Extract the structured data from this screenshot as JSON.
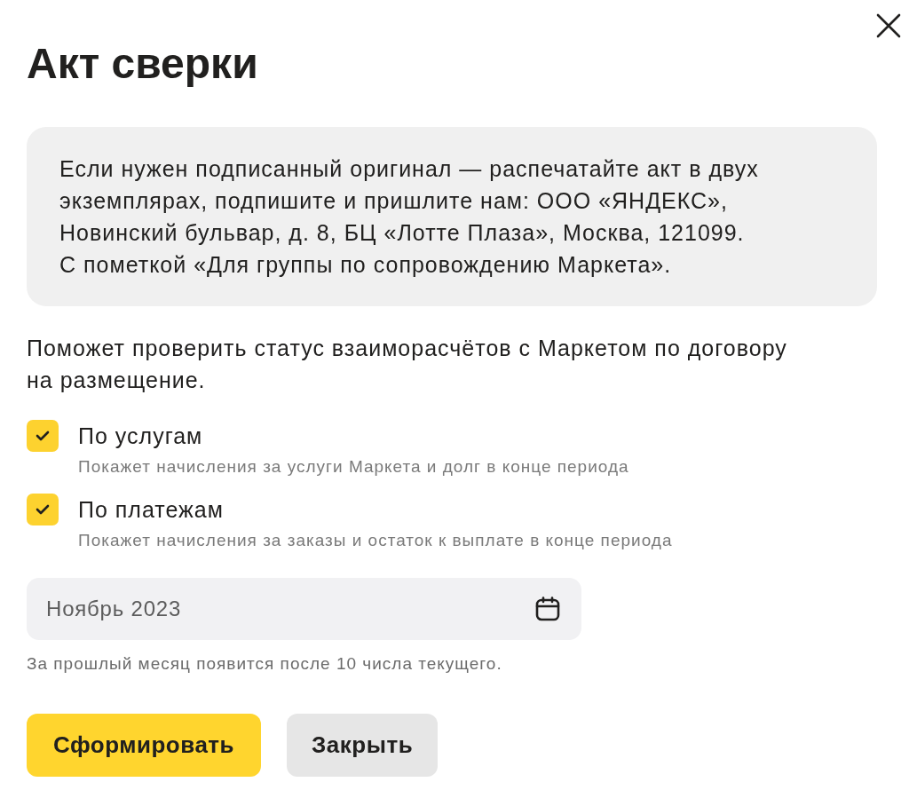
{
  "dialog": {
    "title": "Акт сверки"
  },
  "notice": "Если нужен подписанный оригинал — распечатайте акт в двух экземплярах, подпишите и пришлите нам: ООО «ЯНДЕКС», Новинский бульвар, д. 8, БЦ «Лотте Плаза», Москва, 121099. С пометкой «Для группы по сопровождению Маркета».",
  "intro": "Поможет проверить статус взаиморасчётов с Маркетом по договору на размещение.",
  "options": [
    {
      "label": "По услугам",
      "description": "Покажет начисления за услуги Маркета и долг в конце периода",
      "checked": true
    },
    {
      "label": "По платежам",
      "description": "Покажет начисления за заказы и остаток к выплате в конце периода",
      "checked": true
    }
  ],
  "period_field": {
    "value": "Ноябрь 2023"
  },
  "period_hint": "За прошлый месяц появится после 10 числа текущего.",
  "buttons": [
    {
      "label": "Сформировать",
      "kind": "primary"
    },
    {
      "label": "Закрыть",
      "kind": "secondary"
    }
  ]
}
